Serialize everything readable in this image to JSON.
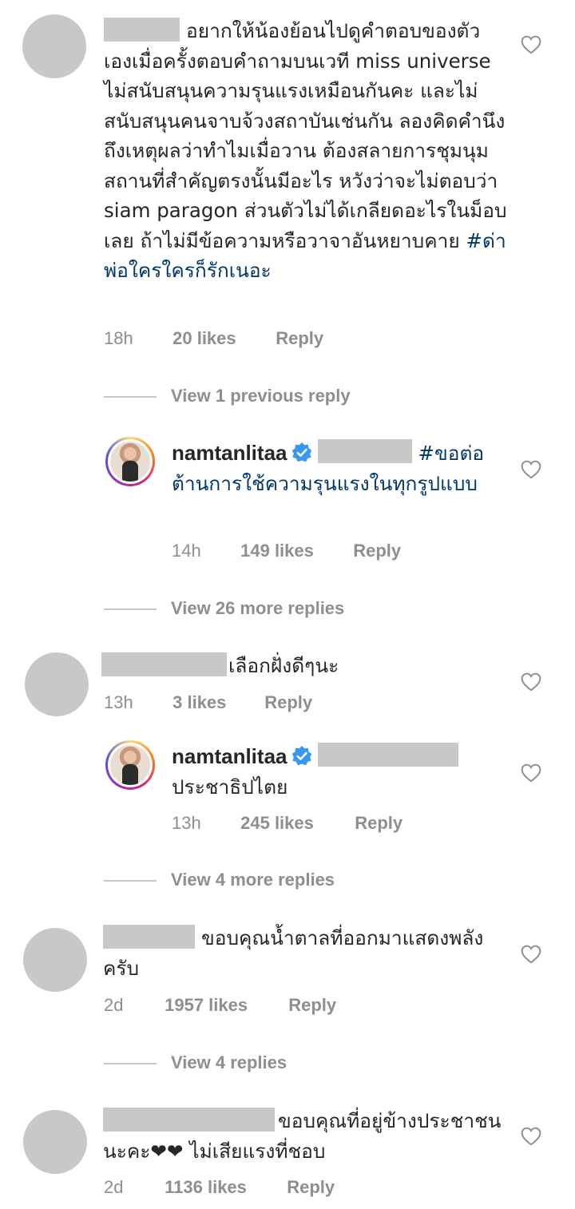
{
  "comments": [
    {
      "text": "อยากให้น้องย้อนไปดูคำตอบของตัวเองเมื่อครั้งตอบคำถามบนเวที miss universe ไม่สนับสนุนความรุนแรงเหมือนกันคะ และไม่สนับสนุนคนจาบจ้วงสถาบันเช่นกัน ลองคิดคำนึงถึงเหตุผลว่าทำไมเมื่อวาน ต้องสลายการชุมนุม สถานที่สำคัญตรงนั้นมีอะไร หวังว่าจะไม่ตอบว่า siam paragon ส่วนตัวไม่ได้เกลียดอะไรในม็อบเลย ถ้าไม่มีข้อความหรือวาจาอันหยาบคาย",
      "hashtag": "#ด่าพ่อใครใครก็รักเนอะ",
      "time": "18h",
      "likes": "20 likes",
      "reply": "Reply"
    },
    {
      "view_replies": "View 1 previous reply"
    },
    {
      "username": "namtanlitaa",
      "hashtag": "#ขอต่อต้านการใช้ความรุนแรงในทุกรูปแบบ",
      "time": "14h",
      "likes": "149 likes",
      "reply": "Reply"
    },
    {
      "view_replies": "View 26 more replies"
    },
    {
      "text": "เลือกฝั่งดีๆนะ",
      "time": "13h",
      "likes": "3 likes",
      "reply": "Reply"
    },
    {
      "username": "namtanlitaa",
      "text": "ประชาธิปไตย",
      "time": "13h",
      "likes": "245 likes",
      "reply": "Reply"
    },
    {
      "view_replies": "View 4 more replies"
    },
    {
      "text": "ขอบคุณน้ำตาลที่ออกมาแสดงพลังครับ",
      "time": "2d",
      "likes": "1957 likes",
      "reply": "Reply"
    },
    {
      "view_replies": "View 4 replies"
    },
    {
      "text": "ขอบคุณที่อยู่ข้างประชาชนนะคะ❤❤ ไม่เสียแรงที่ชอบ",
      "time": "2d",
      "likes": "1136 likes",
      "reply": "Reply"
    }
  ],
  "icons": {
    "like": "heart-outline-icon",
    "verified": "verified-badge-icon"
  },
  "colors": {
    "hashtag": "#00376b",
    "secondary_text": "#8e8e8e",
    "verified": "#3897f0"
  }
}
